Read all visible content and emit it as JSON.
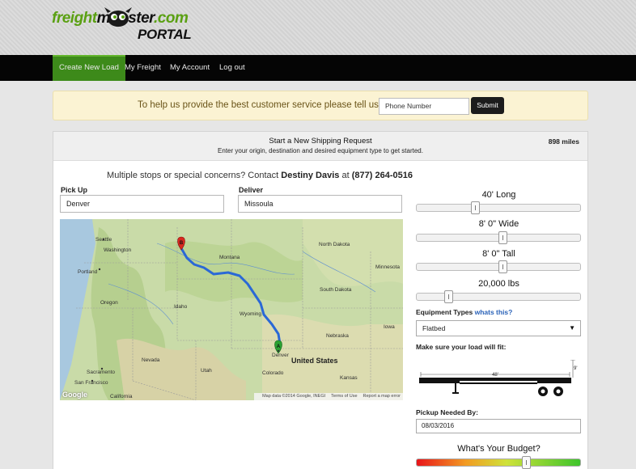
{
  "brand": {
    "logo_part1": "freight",
    "logo_part2": "monster",
    "logo_part3": ".com",
    "logo_sub": "PORTAL",
    "accent": "#5aa012"
  },
  "nav": {
    "items": [
      {
        "label": "Create New Load",
        "active": true
      },
      {
        "label": "My Freight",
        "active": false
      },
      {
        "label": "My Account",
        "active": false
      },
      {
        "label": "Log out",
        "active": false
      }
    ]
  },
  "banner": {
    "message": "To help us provide the best customer service please tell us your",
    "phone_placeholder": "Phone Number",
    "submit_label": "Submit"
  },
  "request": {
    "title": "Start a New Shipping Request",
    "subtitle": "Enter your origin, destination and desired equipment type to get started.",
    "miles": "898 miles",
    "contact_prefix": "Multiple stops or special concerns? Contact",
    "contact_name": "Destiny Davis",
    "contact_at": "at",
    "contact_phone": "(877) 264-0516",
    "pickup_label": "Pick Up",
    "pickup_value": "Denver",
    "deliver_label": "Deliver",
    "deliver_value": "Missoula"
  },
  "map": {
    "cities": [
      "Seattle",
      "Washington",
      "Portland",
      "Oregon",
      "Idaho",
      "Montana",
      "Wyoming",
      "Nevada",
      "Utah",
      "Colorado",
      "Sacramento",
      "San Francisco",
      "California",
      "Denver",
      "Nebraska",
      "Kansas",
      "North Dakota",
      "South Dakota",
      "Minnesota",
      "Iowa"
    ],
    "country": "United States",
    "marker_a": "A",
    "marker_b": "B",
    "google": "Google",
    "attrib_data": "Map data ©2014 Google, INEGI",
    "attrib_terms": "Terms of Use",
    "attrib_report": "Report a map error",
    "route_color": "#2a68d6"
  },
  "equipment": {
    "length": "40' Long",
    "length_value": 0.35,
    "width": "8' 0\" Wide",
    "width_value": 0.53,
    "height": "8' 0\" Tall",
    "height_value": 0.53,
    "weight": "20,000 lbs",
    "weight_value": 0.18,
    "types_label": "Equipment Types",
    "types_link": "whats this?",
    "type_selected": "Flatbed",
    "fit_label": "Make sure your load will fit:",
    "trailer_length": "48'",
    "trailer_height": "9'",
    "pickup_needed_label": "Pickup Needed By:",
    "pickup_date": "08/03/2016",
    "budget_label": "What's Your Budget?",
    "budget_value": 0.68
  }
}
